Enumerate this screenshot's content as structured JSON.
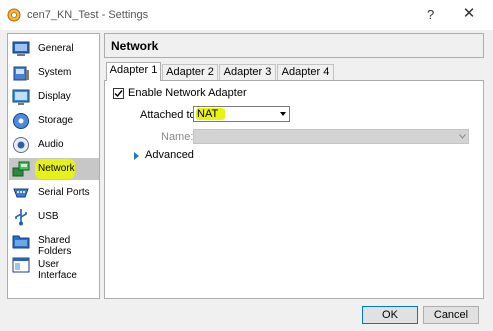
{
  "window": {
    "title": "cen7_KN_Test - Settings",
    "help_label": "?",
    "close_label": "✕"
  },
  "sidebar": {
    "items": [
      {
        "label": "General",
        "icon": "general-icon"
      },
      {
        "label": "System",
        "icon": "system-icon"
      },
      {
        "label": "Display",
        "icon": "display-icon"
      },
      {
        "label": "Storage",
        "icon": "storage-icon"
      },
      {
        "label": "Audio",
        "icon": "audio-icon"
      },
      {
        "label": "Network",
        "icon": "network-icon",
        "selected": true,
        "highlighted": true
      },
      {
        "label": "Serial Ports",
        "icon": "serial-ports-icon"
      },
      {
        "label": "USB",
        "icon": "usb-icon"
      },
      {
        "label": "Shared Folders",
        "icon": "shared-folders-icon"
      },
      {
        "label": "User Interface",
        "icon": "user-interface-icon"
      }
    ]
  },
  "page": {
    "title": "Network"
  },
  "tabs": [
    {
      "label": "Adapter 1",
      "active": true
    },
    {
      "label": "Adapter 2"
    },
    {
      "label": "Adapter 3"
    },
    {
      "label": "Adapter 4"
    }
  ],
  "adapter": {
    "enable_label": "Enable Network Adapter",
    "enabled": true,
    "attached_label": "Attached to:",
    "attached_value": "NAT",
    "name_label": "Name:",
    "name_value": "",
    "advanced_label": "Advanced"
  },
  "buttons": {
    "ok": "OK",
    "cancel": "Cancel"
  },
  "colors": {
    "highlight": "#e8f30f",
    "selection": "#c7c7c7",
    "accent": "#1e78d2"
  }
}
